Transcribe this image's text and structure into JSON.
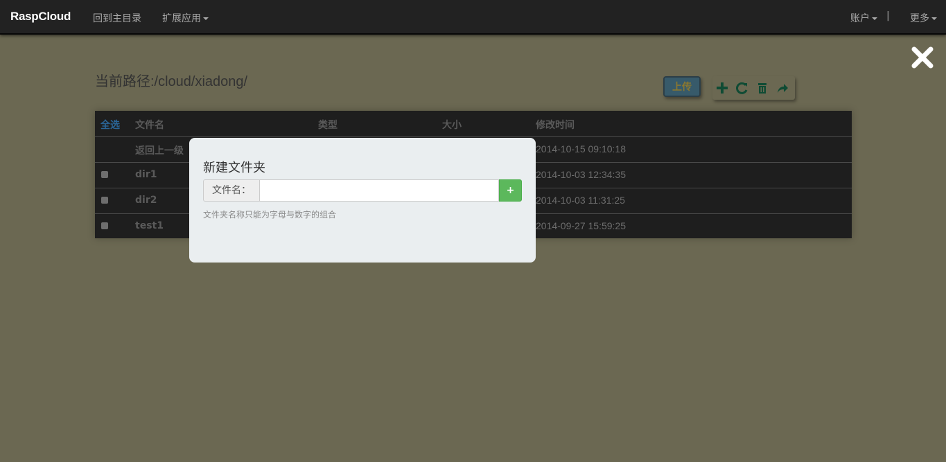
{
  "navbar": {
    "brand": "RaspCloud",
    "home": "回到主目录",
    "apps": "扩展应用",
    "account": "账户",
    "separator": "|",
    "more": "更多"
  },
  "main": {
    "path": "当前路径:/cloud/xiadong/",
    "upload_label": "上传"
  },
  "table": {
    "headers": {
      "select_all": "全选",
      "name": "文件名",
      "type": "类型",
      "size": "大小",
      "mtime": "修改时间"
    },
    "rows": [
      {
        "name": "返回上一级",
        "mtime": "2014-10-15 09:10:18",
        "checkbox": false
      },
      {
        "name": "dir1",
        "mtime": "2014-10-03 12:34:35",
        "checkbox": true
      },
      {
        "name": "dir2",
        "mtime": "2014-10-03 11:31:25",
        "checkbox": true
      },
      {
        "name": "test1",
        "mtime": "2014-09-27 15:59:25",
        "checkbox": true
      }
    ]
  },
  "modal": {
    "title": "新建文件夹",
    "field_label": "文件名：",
    "field_value": "",
    "field_placeholder": "",
    "add_label": "+",
    "help": "文件夹名称只能为字母与数字的组合"
  },
  "icons": {
    "close": "close-icon",
    "add": "plus-icon",
    "refresh": "refresh-icon",
    "delete": "trash-icon",
    "share": "share-icon"
  },
  "colors": {
    "navbar_bg": "#222222",
    "backdrop": "#6b6852",
    "table_bg": "#1e1e1e",
    "modal_bg": "#eaeef0",
    "success": "#5cb85c",
    "toolbar_icon": "#0f4b34"
  }
}
